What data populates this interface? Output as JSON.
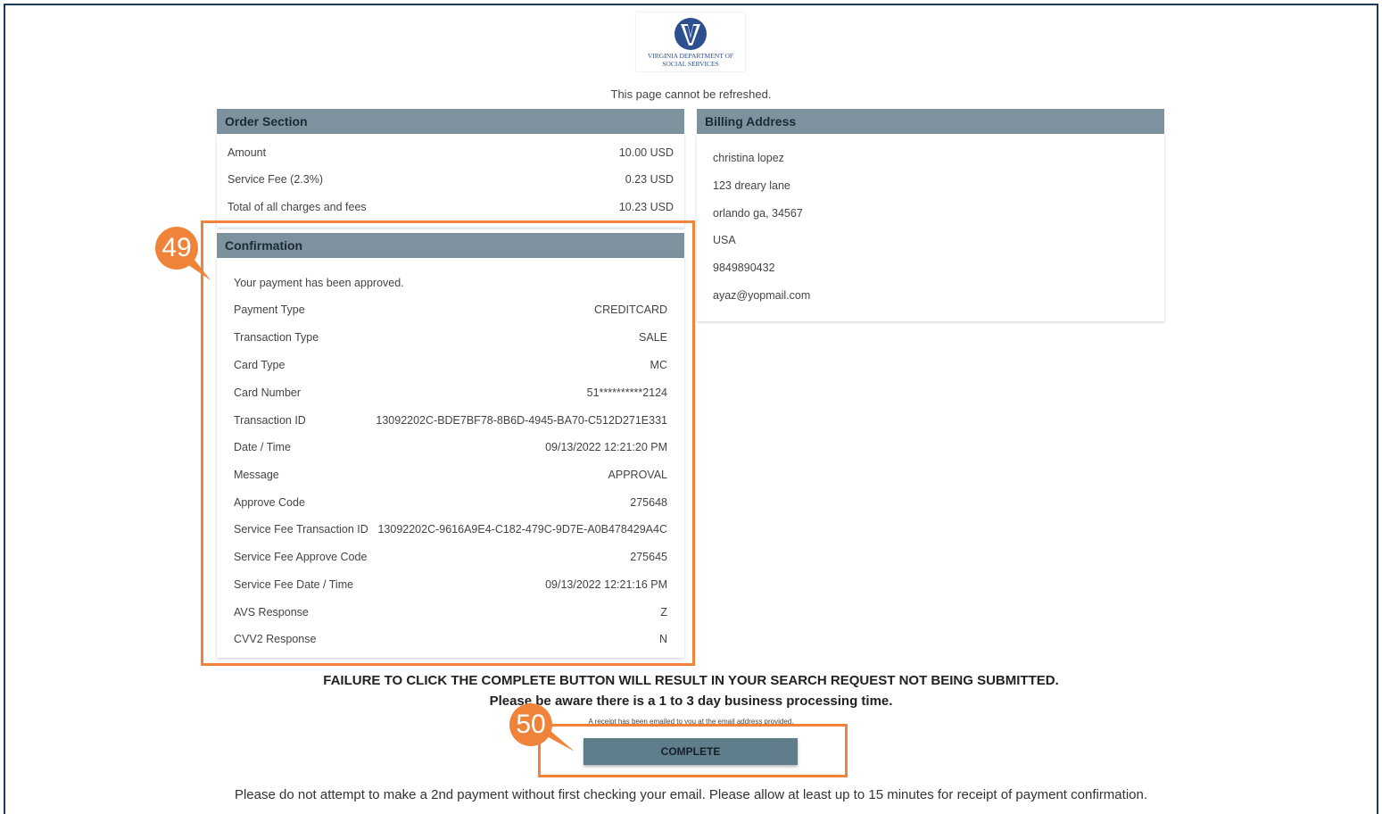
{
  "logo": {
    "line1": "VIRGINIA DEPARTMENT OF",
    "line2": "SOCIAL SERVICES",
    "icon": "vdss-v-logo"
  },
  "notice": "This page cannot be refreshed.",
  "order": {
    "title": "Order Section",
    "rows": [
      {
        "label": "Amount",
        "value": "10.00 USD"
      },
      {
        "label": "Service Fee (2.3%)",
        "value": "0.23 USD"
      },
      {
        "label": "Total of all charges and fees",
        "value": "10.23 USD"
      }
    ]
  },
  "billing": {
    "title": "Billing Address",
    "lines": [
      "christina lopez",
      "123 dreary lane",
      "orlando ga, 34567",
      "USA",
      "9849890432",
      "ayaz@yopmail.com"
    ]
  },
  "confirmation": {
    "title": "Confirmation",
    "message": "Your payment has been approved.",
    "rows": [
      {
        "label": "Payment Type",
        "value": "CREDITCARD"
      },
      {
        "label": "Transaction Type",
        "value": "SALE"
      },
      {
        "label": "Card Type",
        "value": "MC"
      },
      {
        "label": "Card Number",
        "value": "51**********2124"
      },
      {
        "label": "Transaction ID",
        "value": "1309220­2C-BDE7BF78-8B6D-4945-BA70-C512D271E331"
      },
      {
        "label": "Date / Time",
        "value": "09/13/2022 12:21:20 PM"
      },
      {
        "label": "Message",
        "value": "APPROVAL"
      },
      {
        "label": "Approve Code",
        "value": "275648"
      },
      {
        "label": "Service Fee Transaction ID",
        "value": "1309220­2C-9616A9E4-C182-479C-9D7E-A0B478429A4C"
      },
      {
        "label": "Service Fee Approve Code",
        "value": "275645"
      },
      {
        "label": "Service Fee Date / Time",
        "value": "09/13/2022 12:21:16 PM"
      },
      {
        "label": "AVS Response",
        "value": "Z"
      },
      {
        "label": "CVV2 Response",
        "value": "N"
      }
    ]
  },
  "warning": {
    "line1": "FAILURE TO CLICK THE COMPLETE BUTTON WILL RESULT IN YOUR SEARCH REQUEST NOT BEING SUBMITTED.",
    "line2": "Please be aware there is a 1 to 3 day business processing time.",
    "receipt": "A receipt has been emailed to you at the email address provided."
  },
  "complete_label": "COMPLETE",
  "footer": "Please do not attempt to make a 2nd payment without first checking your email. Please allow at least up to 15 minutes for receipt of payment confirmation.",
  "annotations": {
    "step49": "49",
    "step50": "50"
  },
  "colors": {
    "header_bg": "#7d929e",
    "button_bg": "#607d8b",
    "highlight": "#f0833a",
    "frame": "#1f3a56"
  }
}
